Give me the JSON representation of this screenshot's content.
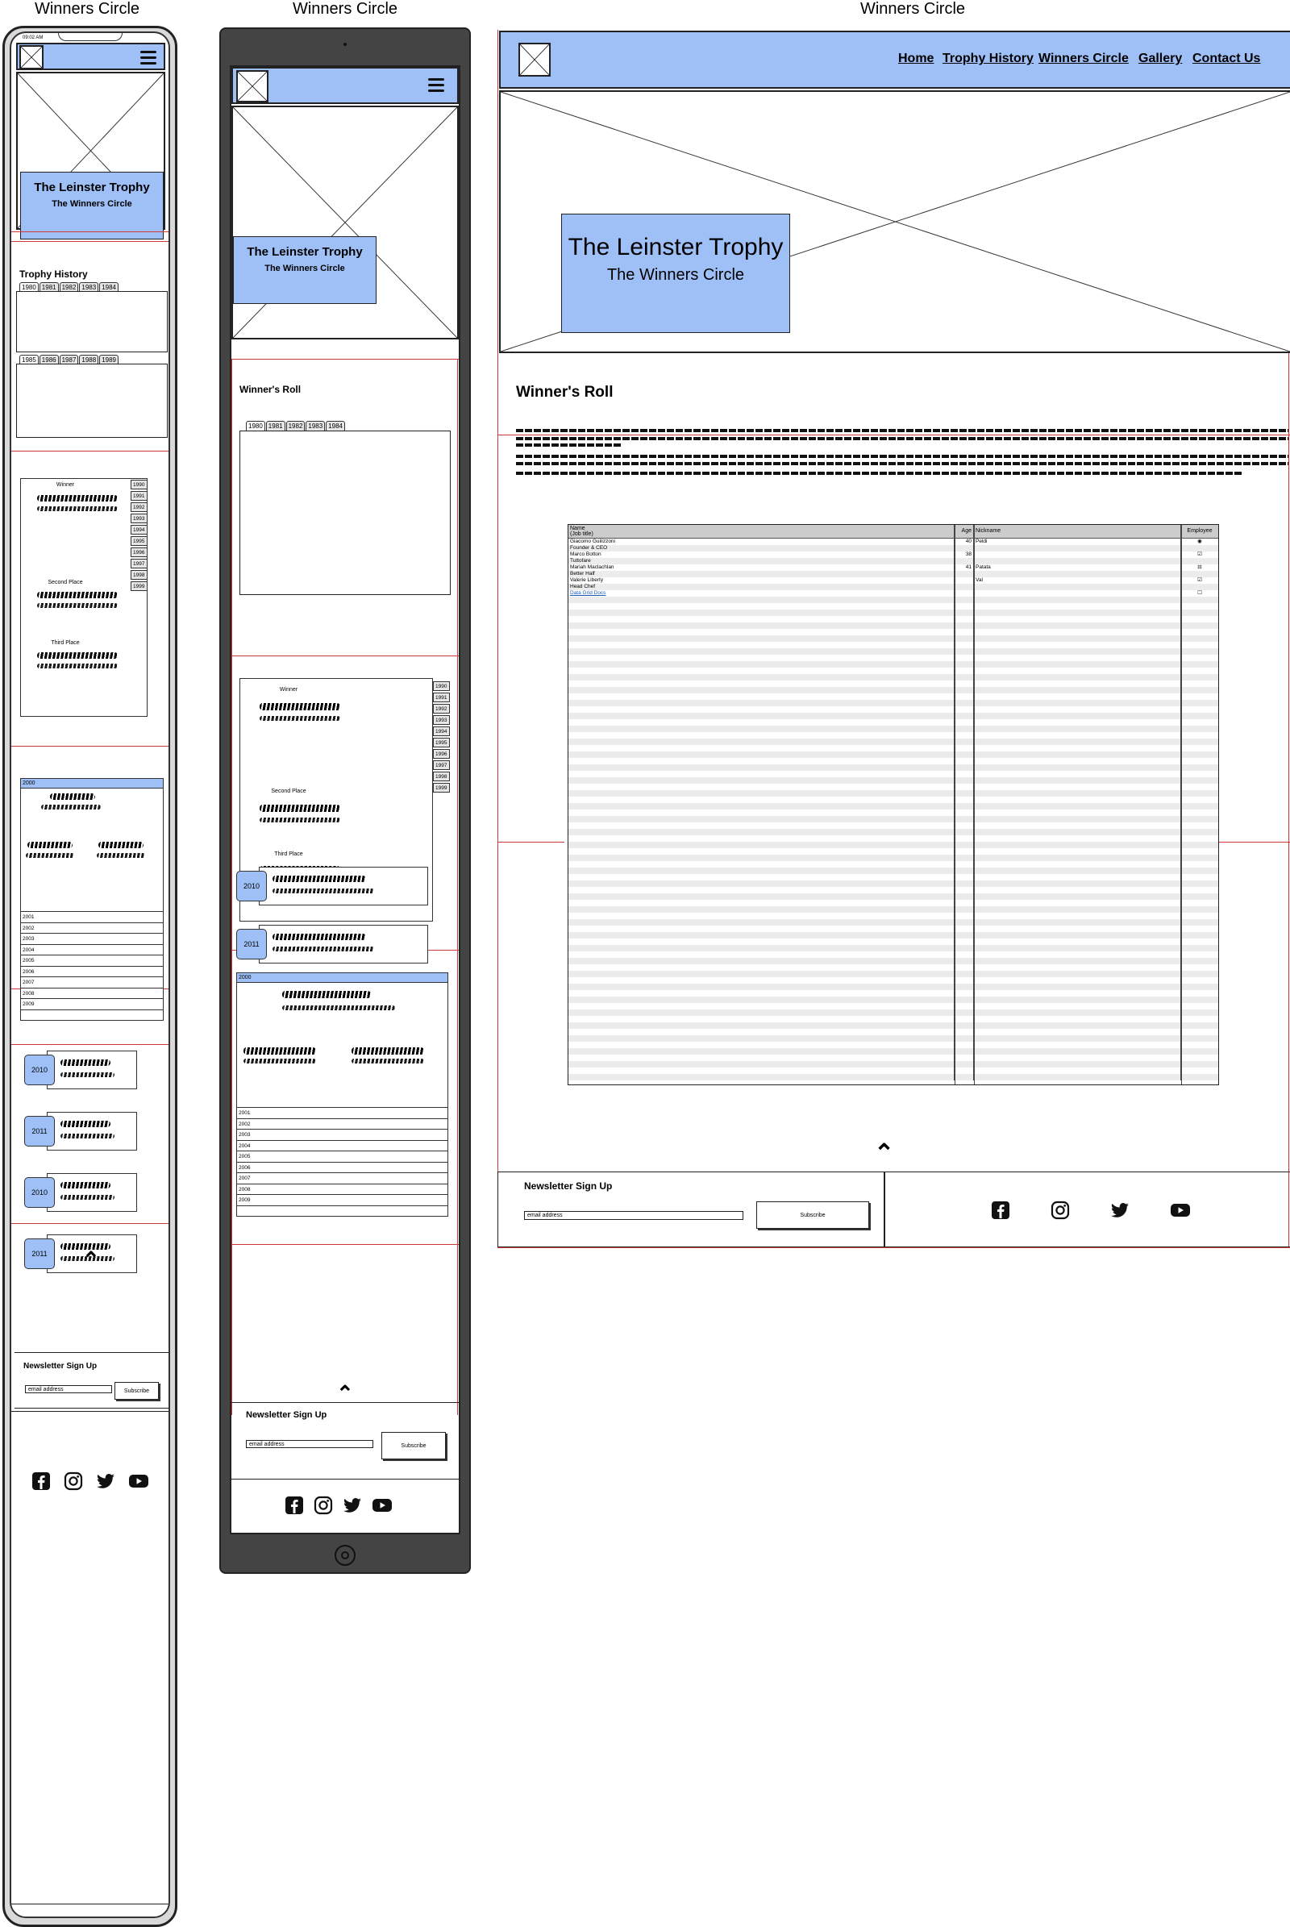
{
  "frame_title": "Winners Circle",
  "phone": {
    "status_time": "09:02 AM",
    "hero_title": "The Leinster Trophy",
    "hero_subtitle": "The Winners Circle",
    "trophy_history_label": "Trophy History",
    "tabs_set1": [
      "1980",
      "1981",
      "1982",
      "1983",
      "1984"
    ],
    "tabs_set2": [
      "1985",
      "1986",
      "1987",
      "1988",
      "1989"
    ],
    "winner_label": "Winner",
    "second_label": "Second Place",
    "third_label": "Third Place",
    "year_tabs": [
      "1990",
      "1991",
      "1992",
      "1993",
      "1994",
      "1995",
      "1996",
      "1997",
      "1998",
      "1999"
    ],
    "list_header": "2000",
    "list_rows": [
      "2001",
      "2002",
      "2003",
      "2004",
      "2005",
      "2006",
      "2007",
      "2008",
      "2009"
    ],
    "cards": [
      "2010",
      "2011",
      "2010",
      "2011"
    ],
    "newsletter_title": "Newsletter Sign Up",
    "email_placeholder": "email address",
    "subscribe": "Subscribe"
  },
  "tablet": {
    "hero_title": "The Leinster Trophy",
    "hero_subtitle": "The Winners Circle",
    "winners_roll": "Winner's Roll",
    "tabs": [
      "1980",
      "1981",
      "1982",
      "1983",
      "1984"
    ],
    "winner_label": "Winner",
    "second_label": "Second Place",
    "third_label": "Third Place",
    "year_tabs": [
      "1990",
      "1991",
      "1992",
      "1993",
      "1994",
      "1995",
      "1996",
      "1997",
      "1998",
      "1999"
    ],
    "list_header": "2000",
    "list_rows": [
      "2001",
      "2002",
      "2003",
      "2004",
      "2005",
      "2006",
      "2007",
      "2008",
      "2009"
    ],
    "cards": [
      "2010",
      "2011"
    ],
    "newsletter_title": "Newsletter Sign Up",
    "email_placeholder": "email address",
    "subscribe": "Subscribe"
  },
  "desktop": {
    "nav": [
      "Home",
      "Trophy History",
      "Winners Circle",
      "Gallery",
      "Contact Us"
    ],
    "hero_title": "The Leinster Trophy",
    "hero_subtitle": "The Winners Circle",
    "winners_roll": "Winner's Roll",
    "grid": {
      "headers": [
        "Name\n(Job title)",
        "Age",
        "Nickname",
        "Employee"
      ],
      "rows": [
        {
          "name": "Giacomo Guilizzoni",
          "age": "40",
          "nick": "Peldi",
          "emp": "radio"
        },
        {
          "name": "Founder & CEO",
          "age": "",
          "nick": "",
          "emp": ""
        },
        {
          "name": "Marco Botton",
          "age": "38",
          "nick": "",
          "emp": "checked"
        },
        {
          "name": "Tuttofare",
          "age": "",
          "nick": "",
          "emp": ""
        },
        {
          "name": "Mariah Maclachlan",
          "age": "41",
          "nick": "Patata",
          "emp": "indeterminate"
        },
        {
          "name": "Better Half",
          "age": "",
          "nick": "",
          "emp": ""
        },
        {
          "name": "Valerie Liberty",
          "age": "",
          "nick": "Val",
          "emp": "checked"
        },
        {
          "name": "Head Chef",
          "age": "",
          "nick": "",
          "emp": ""
        },
        {
          "name": "Data Grid Docs",
          "age": "",
          "nick": "",
          "emp": "unchecked"
        }
      ]
    },
    "newsletter_title": "Newsletter Sign Up",
    "email_placeholder": "email address",
    "subscribe": "Subscribe"
  },
  "icons": [
    "facebook-icon",
    "instagram-icon",
    "twitter-icon",
    "youtube-icon"
  ]
}
